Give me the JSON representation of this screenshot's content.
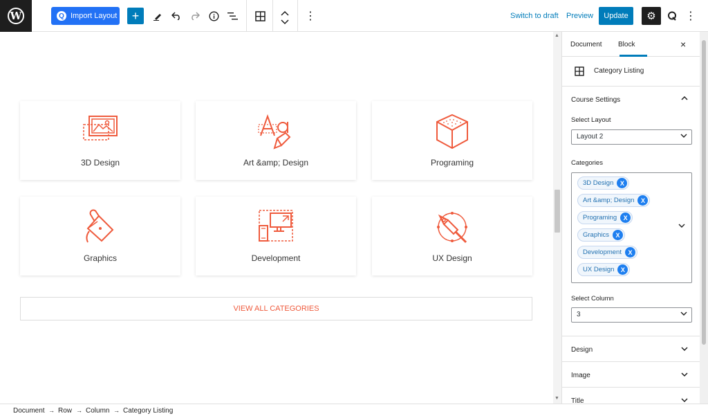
{
  "toolbar": {
    "import_label": "Import Layout",
    "add_label": "+",
    "switch_draft": "Switch to draft",
    "preview": "Preview",
    "update": "Update"
  },
  "canvas": {
    "categories": [
      {
        "label": "3D Design",
        "icon": "picture-frame-icon"
      },
      {
        "label": "Art &amp; Design",
        "icon": "typography-pen-icon"
      },
      {
        "label": "Programing",
        "icon": "cube-icon"
      },
      {
        "label": "Graphics",
        "icon": "paint-bucket-icon"
      },
      {
        "label": "Development",
        "icon": "responsive-devices-icon"
      },
      {
        "label": "UX Design",
        "icon": "pen-tool-icon"
      }
    ],
    "view_all": "VIEW ALL CATEGORIES",
    "accent_color": "#ef5a3c"
  },
  "sidebar": {
    "tabs": [
      "Document",
      "Block"
    ],
    "active_tab": "Block",
    "block_name": "Category Listing",
    "course_settings": "Course Settings",
    "select_layout_label": "Select Layout",
    "select_layout_value": "Layout 2",
    "categories_label": "Categories",
    "chips": [
      "3D Design",
      "Art &amp; Design",
      "Programing",
      "Graphics",
      "Development",
      "UX Design"
    ],
    "chip_remove": "X",
    "select_column_label": "Select Column",
    "select_column_value": "3",
    "panels": [
      "Design",
      "Image",
      "Title"
    ]
  },
  "breadcrumb": [
    "Document",
    "Row",
    "Column",
    "Category Listing"
  ],
  "breadcrumb_separator": "→"
}
